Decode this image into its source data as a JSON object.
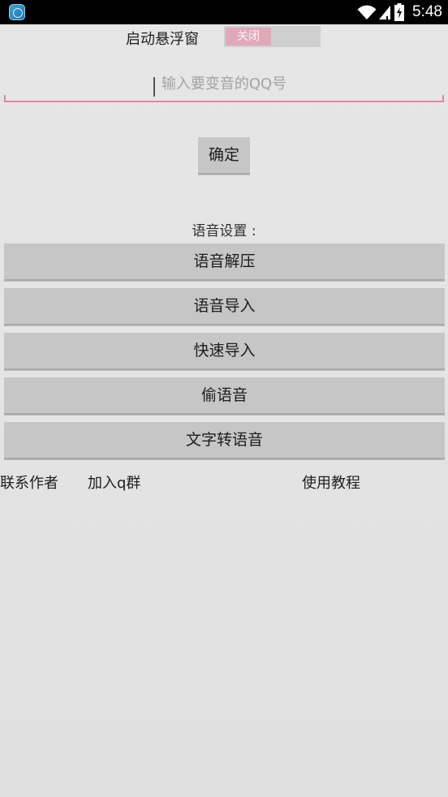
{
  "status_bar": {
    "time": "5:48",
    "icons": [
      "app-icon",
      "wifi-icon",
      "signal-icon",
      "battery-icon"
    ]
  },
  "float_window": {
    "label": "启动悬浮窗",
    "toggle_text": "关闭",
    "toggle_on": false
  },
  "qq_input": {
    "value": "",
    "placeholder": "输入要变音的QQ号"
  },
  "confirm_label": "确定",
  "voice_settings": {
    "title": "语音设置 :",
    "buttons": [
      "语音解压",
      "语音导入",
      "快速导入",
      "偷语音",
      "文字转语音"
    ]
  },
  "links": {
    "contact": "联系作者",
    "join_group": "加入q群",
    "tutorial": "使用教程"
  },
  "colors": {
    "accent_pink": "#d98ba3",
    "button_gray": "#c6c6c6",
    "background": "#e4e4e4"
  }
}
